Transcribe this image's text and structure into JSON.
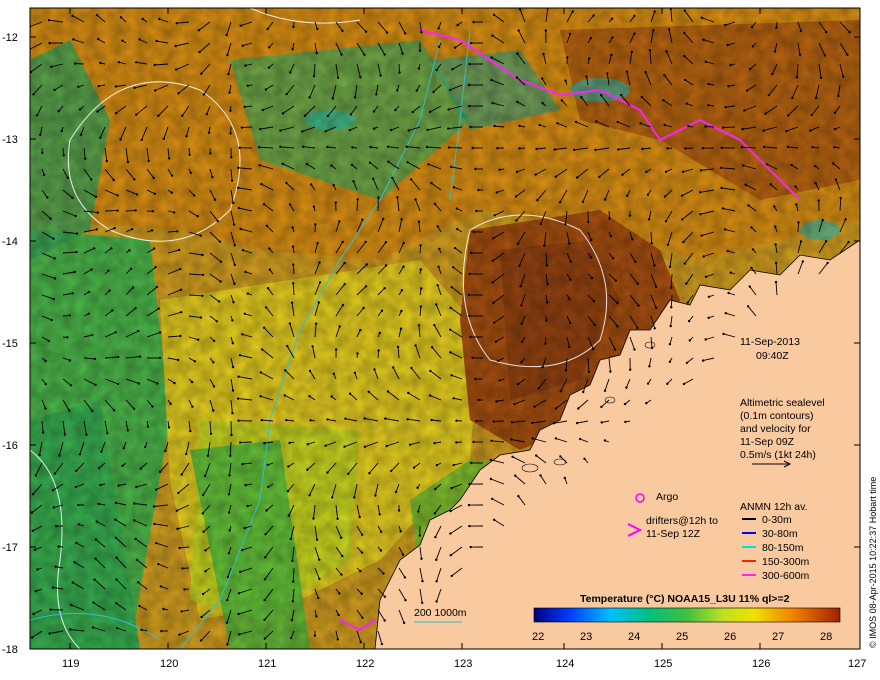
{
  "map": {
    "lat_ticks": [
      "-12",
      "-13",
      "-14",
      "-15",
      "-16",
      "-17",
      "-18"
    ],
    "lon_ticks": [
      "119",
      "120",
      "121",
      "122",
      "123",
      "124",
      "125",
      "126",
      "127"
    ],
    "date": "11-Sep-2013",
    "time": "09:40Z",
    "altimetry_lines": [
      "Altimetric sealevel",
      "(0.1m contours)",
      "and velocity for",
      "11-Sep 09Z",
      "0.5m/s (1kt 24h)"
    ],
    "argo_label": "Argo",
    "drifters_lines": [
      "drifters@12h to",
      "11-Sep 12Z"
    ],
    "anmn_title": "ANMN 12h av.",
    "anmn_depths": [
      {
        "label": "0-30m",
        "color": "#000000"
      },
      {
        "label": "30-80m",
        "color": "#0000ff"
      },
      {
        "label": "80-150m",
        "color": "#00e0e0"
      },
      {
        "label": "150-300m",
        "color": "#ff2000"
      },
      {
        "label": "300-600m",
        "color": "#ff20ff"
      }
    ],
    "isobath_label": "200  1000m",
    "colorbar_title": "Temperature (°C) NOAA15_L3U 11% ql>=2",
    "colorbar_ticks": [
      "22",
      "23",
      "24",
      "25",
      "26",
      "27",
      "28"
    ],
    "credit": "© IMOS 08-Apr-2015 10:22:37 Hobart time",
    "land_color": "#f9c9a0"
  }
}
